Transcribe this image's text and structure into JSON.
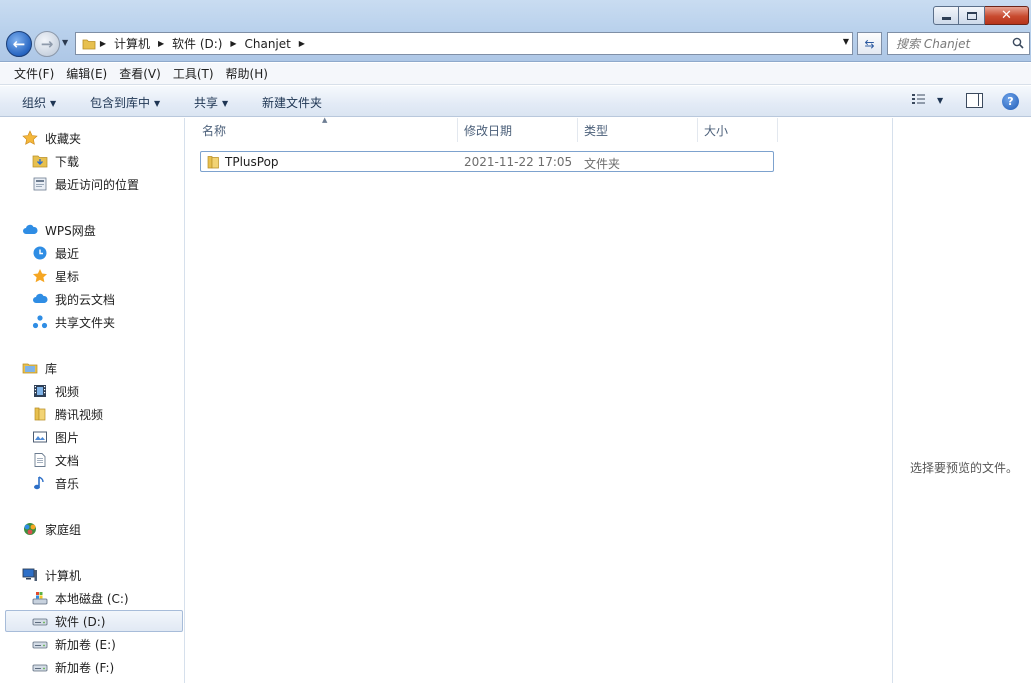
{
  "window": {
    "controls": {
      "minimize": "minimize",
      "maximize": "maximize",
      "close": "close"
    }
  },
  "address": {
    "crumbs": [
      "计算机",
      "软件 (D:)",
      "Chanjet"
    ]
  },
  "search": {
    "placeholder": "搜索 Chanjet"
  },
  "menu": {
    "items": [
      "文件(F)",
      "编辑(E)",
      "查看(V)",
      "工具(T)",
      "帮助(H)"
    ]
  },
  "toolbar": {
    "organize": "组织",
    "include_library": "包含到库中",
    "share": "共享",
    "new_folder": "新建文件夹"
  },
  "nav": {
    "favorites": {
      "label": "收藏夹",
      "items": [
        "下载",
        "最近访问的位置"
      ]
    },
    "wps": {
      "label": "WPS网盘",
      "items": [
        "最近",
        "星标",
        "我的云文档",
        "共享文件夹"
      ]
    },
    "libraries": {
      "label": "库",
      "items": [
        "视频",
        "腾讯视频",
        "图片",
        "文档",
        "音乐"
      ]
    },
    "homegroup": {
      "label": "家庭组"
    },
    "computer": {
      "label": "计算机",
      "items": [
        "本地磁盘 (C:)",
        "软件 (D:)",
        "新加卷 (E:)",
        "新加卷 (F:)"
      ],
      "selected": "软件 (D:)"
    }
  },
  "filelist": {
    "columns": [
      "名称",
      "修改日期",
      "类型",
      "大小"
    ],
    "rows": [
      {
        "name": "TPlusPop",
        "modified": "2021-11-22 17:05",
        "type": "文件夹",
        "size": ""
      }
    ]
  },
  "preview": {
    "message": "选择要预览的文件。"
  },
  "colors": {
    "accent": "#2765c1",
    "close_button": "#c84a2f",
    "folder": "#e7c04f",
    "selection_border": "#7da2ce"
  }
}
